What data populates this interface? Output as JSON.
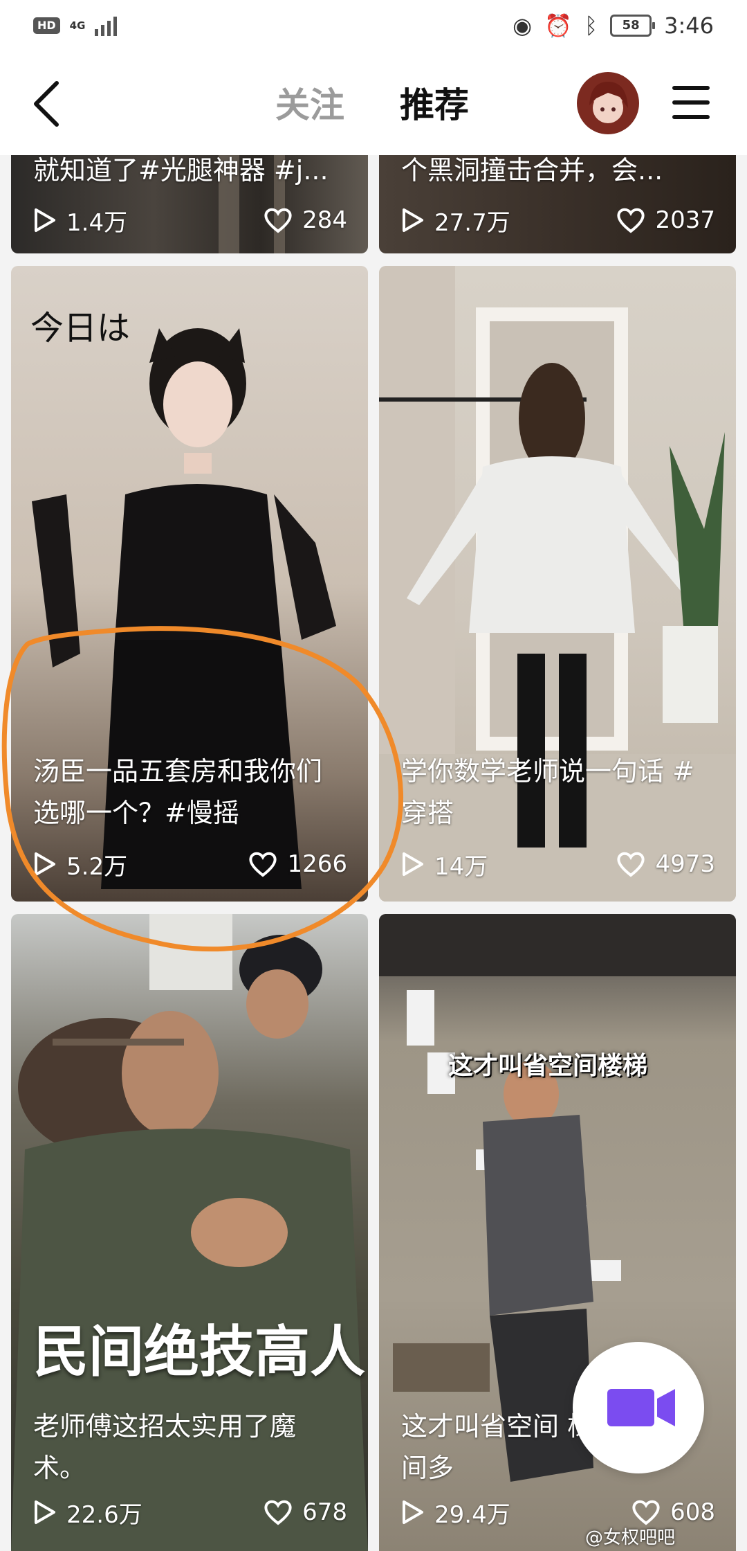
{
  "status_bar": {
    "hd": "HD",
    "network": "4G",
    "battery": "58",
    "time": "3:46"
  },
  "nav": {
    "tab_follow": "关注",
    "tab_recommend": "推荐"
  },
  "cards": [
    {
      "title": "就知道了#光腿神器 #j...",
      "views": "1.4万",
      "likes": "284"
    },
    {
      "title": "个黑洞撞击合并，会...",
      "views": "27.7万",
      "likes": "2037"
    },
    {
      "overlay": "今日は",
      "title": "汤臣一品五套房和我你们选哪一个？#慢摇",
      "views": "5.2万",
      "likes": "1266"
    },
    {
      "title": "学你数学老师说一句话 #穿搭",
      "views": "14万",
      "likes": "4973"
    },
    {
      "overlay": "民间绝技高人",
      "title": "老师傅这招太实用了魔术。",
      "views": "22.6万",
      "likes": "678"
    },
    {
      "overlay": "这才叫省空间楼梯",
      "title": "这才叫省空间 梯这样做空间多",
      "views": "29.4万",
      "likes": "608"
    }
  ],
  "watermark": "@女权吧吧",
  "colors": {
    "accent": "#7b4cf0",
    "annotation": "#f08a2a"
  }
}
